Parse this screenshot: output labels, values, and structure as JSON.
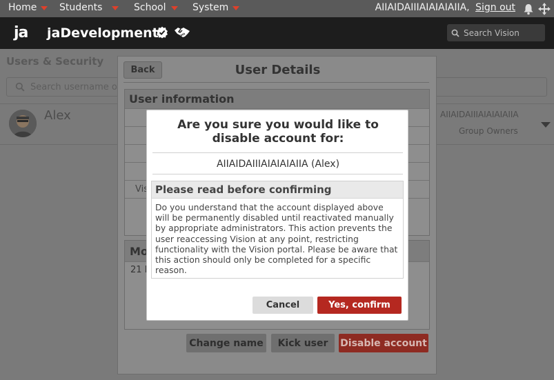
{
  "topnav": {
    "items": [
      {
        "label": "Home"
      },
      {
        "label": "Students"
      },
      {
        "label": "School"
      },
      {
        "label": "System"
      }
    ],
    "user_name": "AIIAIDAIIIAIAIAIAIIA,",
    "signout_label": "Sign out"
  },
  "header": {
    "logo": "ja",
    "brand": "jaDevelopment",
    "search_placeholder": "Search Vision"
  },
  "background": {
    "page_title": "Users & Security",
    "search_placeholder": "Search username o",
    "user_row": {
      "name": "Alex",
      "login": "AIIAIDAIIIAIAIAIAIIA",
      "group": "Group Owners"
    }
  },
  "user_details": {
    "back_label": "Back",
    "title": "User Details",
    "info_heading": "User information",
    "visible_row_fragment": "Vis",
    "modify_heading": "Mo",
    "modify_sub": "21 F",
    "buttons": {
      "change_name": "Change name",
      "kick_user": "Kick user",
      "disable_account": "Disable account"
    }
  },
  "modal": {
    "title": "Are you sure you would like to disable account for:",
    "account": "AIIAIDAIIIAIAIAIAIIA (Alex)",
    "notice_heading": "Please read before confirming",
    "notice_body": "Do you understand that the account displayed above will be permanently disabled until reactivated manually by appropriate administrators. This action prevents the user reaccessing Vision at any point, restricting functionality with the Vision portal. Please be aware that this action should only be completed for a specific reason.",
    "cancel_label": "Cancel",
    "confirm_label": "Yes, confirm"
  },
  "colors": {
    "accent_red": "#b52820",
    "nav_caret": "#e0402a",
    "header_bg": "#1d1d1d"
  },
  "icons": [
    "caret-down-icon",
    "bell-icon",
    "move-icon",
    "verified-badge-icon",
    "handshake-icon",
    "search-icon",
    "avatar"
  ]
}
